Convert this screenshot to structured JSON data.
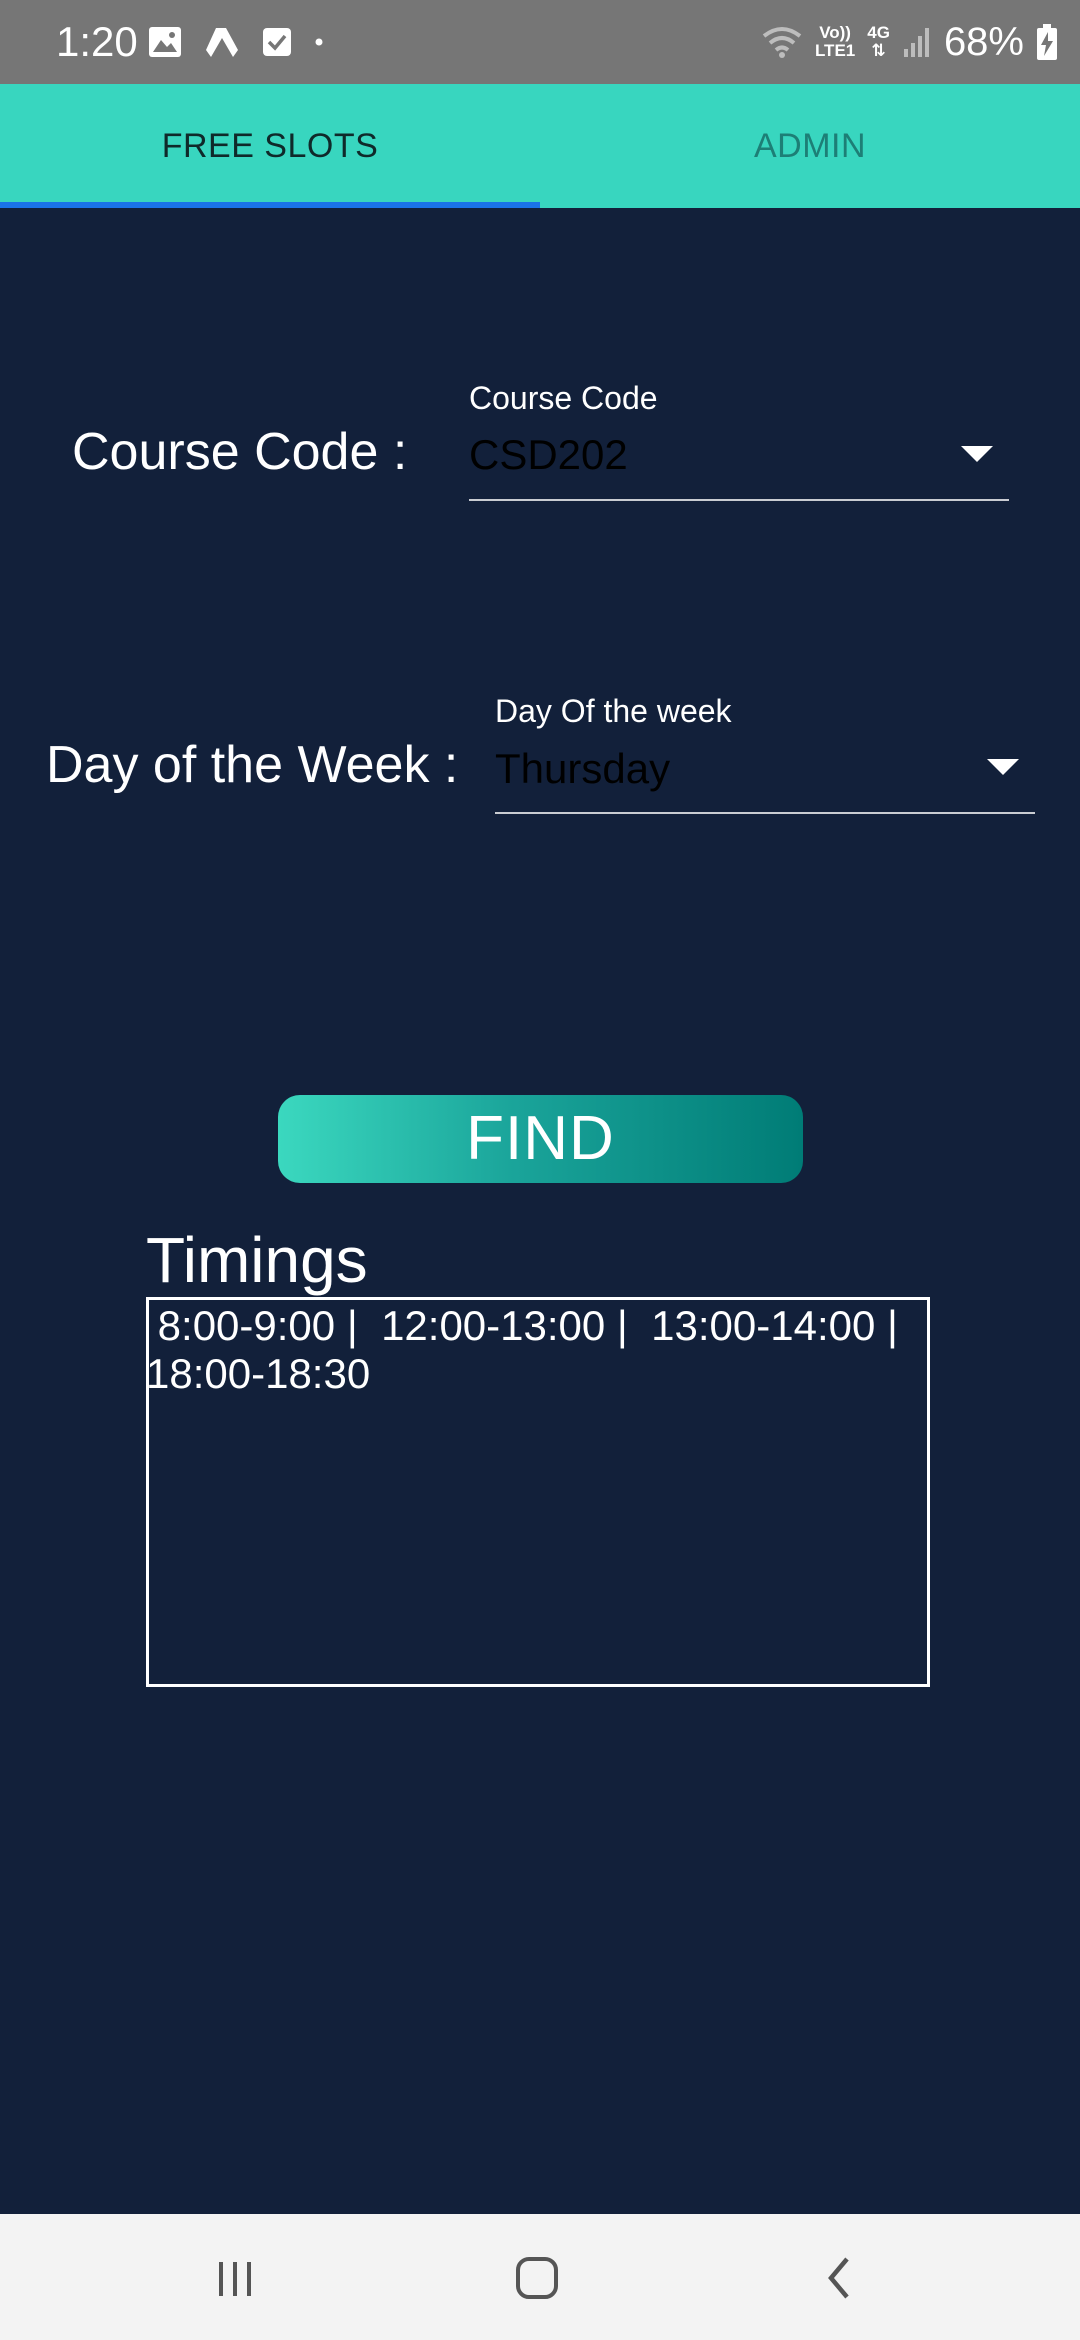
{
  "status_bar": {
    "time": "1:20",
    "network_top": "Vo))",
    "network_bottom": "LTE1",
    "network_type": "4G",
    "battery": "68%",
    "icons": [
      "image-icon",
      "drive-icon",
      "checkbox-icon",
      "dot-icon",
      "wifi-icon",
      "signal-icon",
      "battery-charging-icon"
    ]
  },
  "tabs": [
    {
      "label": "FREE SLOTS",
      "selected": true
    },
    {
      "label": "ADMIN",
      "selected": false
    }
  ],
  "form": {
    "course": {
      "label": "Course Code :",
      "floating_label": "Course Code",
      "value": "CSD202"
    },
    "day": {
      "label": "Day of the Week :",
      "floating_label": "Day Of the week",
      "value": "Thursday"
    }
  },
  "find_button": {
    "label": "FIND"
  },
  "timings": {
    "title": "Timings",
    "text": " 8:00-9:00 |  12:00-13:00 |  13:00-14:00 |\n18:00-18:30"
  },
  "nav_bar": {
    "buttons": [
      "recent-apps-icon",
      "home-icon",
      "back-icon"
    ]
  },
  "colors": {
    "background": "#12203a",
    "tab_bar": "#38d6bf",
    "tab_indicator": "#1a73e8",
    "status_bar": "#767676",
    "button_gradient_start": "#3bd8bf",
    "button_gradient_end": "#007c76"
  }
}
